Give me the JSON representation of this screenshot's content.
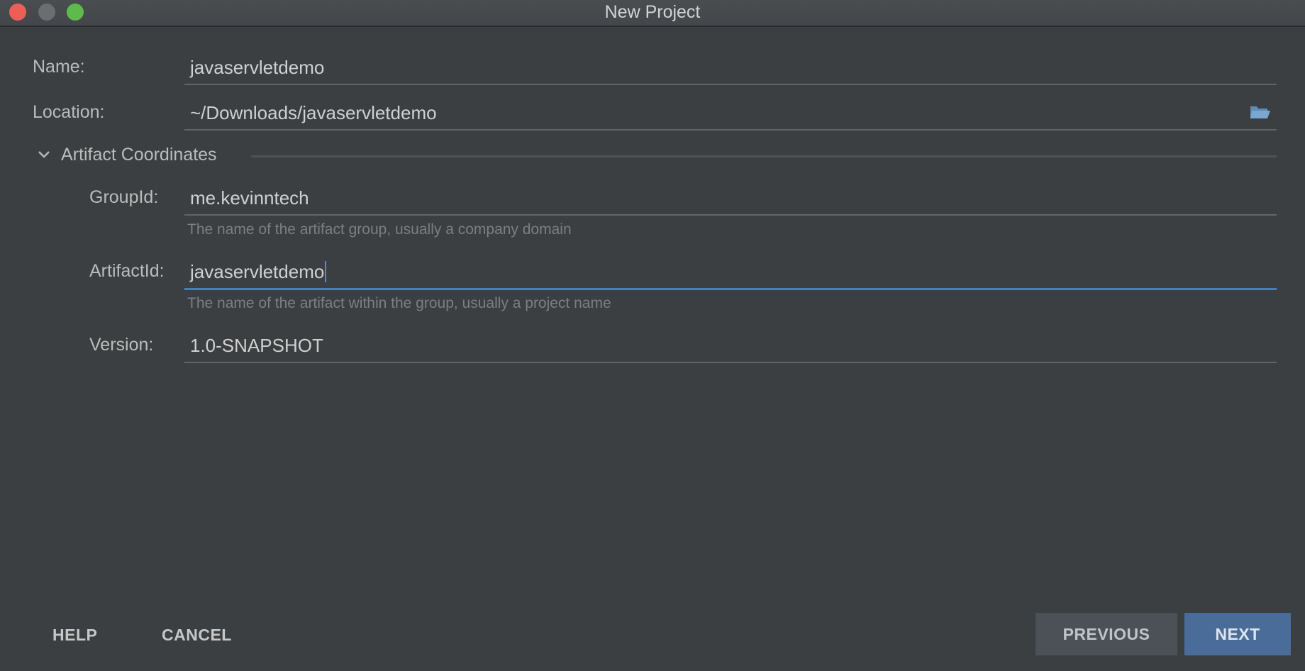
{
  "window": {
    "title": "New Project"
  },
  "form": {
    "name_label": "Name:",
    "name_value": "javaservletdemo",
    "location_label": "Location:",
    "location_value": "~/Downloads/javaservletdemo",
    "location_browse_icon": "folder-open-icon"
  },
  "artifact_section": {
    "title": "Artifact Coordinates",
    "expanded": true,
    "group_id_label": "GroupId:",
    "group_id_value": "me.kevinntech",
    "group_id_hint": "The name of the artifact group, usually a company domain",
    "artifact_id_label": "ArtifactId:",
    "artifact_id_value": "javaservletdemo",
    "artifact_id_hint": "The name of the artifact within the group, usually a project name",
    "version_label": "Version:",
    "version_value": "1.0-SNAPSHOT"
  },
  "footer": {
    "help_label": "HELP",
    "cancel_label": "CANCEL",
    "previous_label": "PREVIOUS",
    "next_label": "NEXT"
  },
  "colors": {
    "background": "#3c3f41",
    "focus_accent": "#4a7eb8",
    "primary_button": "#4a6c99",
    "close": "#ec5f57",
    "maximize": "#5dbb4b"
  }
}
